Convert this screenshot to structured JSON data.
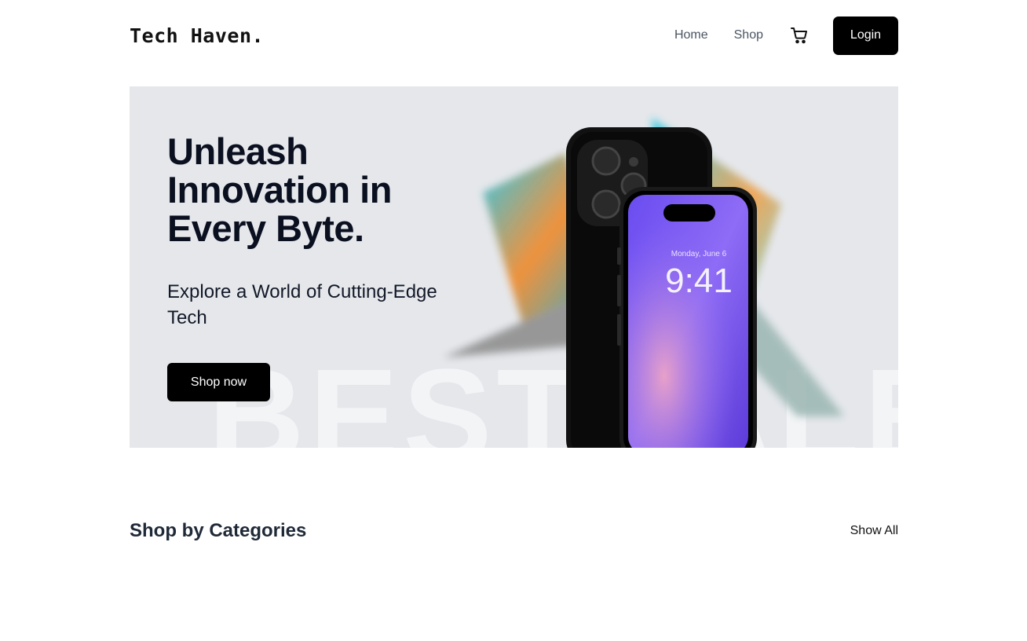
{
  "header": {
    "logo": "Tech Haven.",
    "nav": [
      {
        "label": "Home"
      },
      {
        "label": "Shop"
      }
    ],
    "cart_icon": "cart-icon",
    "login_label": "Login"
  },
  "hero": {
    "title": "Unleash Innovation in Every Byte.",
    "subtitle": "Explore a World of Cutting-Edge Tech",
    "cta_label": "Shop now",
    "watermark": "BESTSALE",
    "phone_date": "Monday, June 6",
    "phone_time": "9:41",
    "background_color": "#e5e7eb",
    "accent_color": "#7c5cf0"
  },
  "categories": {
    "title": "Shop by Categories",
    "show_all_label": "Show All"
  }
}
